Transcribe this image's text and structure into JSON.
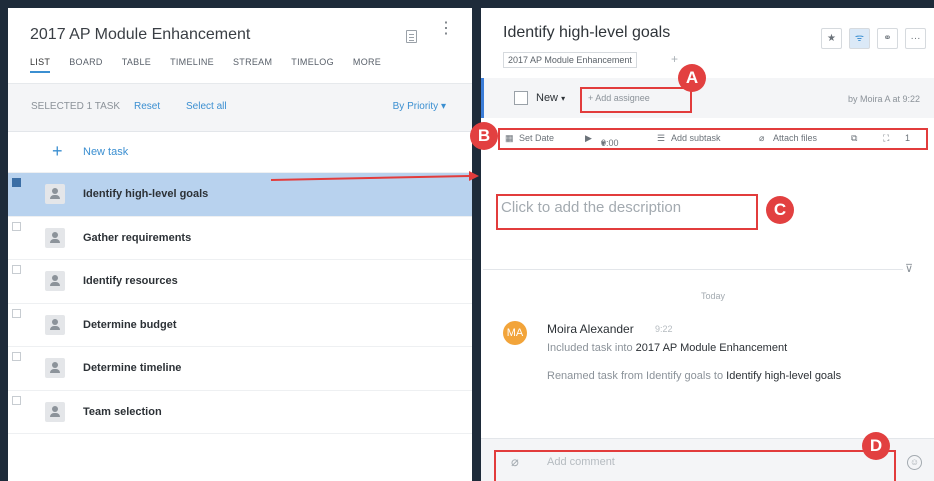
{
  "left": {
    "project_title": "2017 AP Module Enhancement",
    "view_tabs": [
      "LIST",
      "BOARD",
      "TABLE",
      "TIMELINE",
      "STREAM",
      "TIMELOG",
      "MORE"
    ],
    "selection_text": "SELECTED 1 TASK",
    "reset_label": "Reset",
    "select_all_label": "Select all",
    "sort_label": "By Priority",
    "new_task_label": "New task",
    "tasks": [
      {
        "name": "Identify high-level goals",
        "selected": true
      },
      {
        "name": "Gather requirements",
        "selected": false
      },
      {
        "name": "Identify resources",
        "selected": false
      },
      {
        "name": "Determine budget",
        "selected": false
      },
      {
        "name": "Determine timeline",
        "selected": false
      },
      {
        "name": "Team selection",
        "selected": false
      }
    ]
  },
  "right": {
    "title": "Identify high-level goals",
    "project_tag": "2017 AP Module Enhancement",
    "add_tag": "+",
    "status_label": "New",
    "add_assignee_label": "+ Add assignee",
    "created_by": "by Moira A at 9:22",
    "toolbar": {
      "set_date": "Set Date",
      "timer": "0:00",
      "add_subtask": "Add subtask",
      "attach_files": "Attach files",
      "subtask_count": "1"
    },
    "description_placeholder": "Click to add the description",
    "activity_date": "Today",
    "activity": {
      "initials": "MA",
      "author": "Moira Alexander",
      "time": "9:22",
      "line1_prefix": "Included task into ",
      "line1_project": "2017 AP Module Enhancement",
      "line2_prefix": "Renamed task from Identify goals to ",
      "line2_target": "Identify high-level goals"
    },
    "comment_placeholder": "Add comment"
  },
  "annotations": {
    "markers": [
      "A",
      "B",
      "C",
      "D"
    ],
    "color": "#e23c3c"
  }
}
